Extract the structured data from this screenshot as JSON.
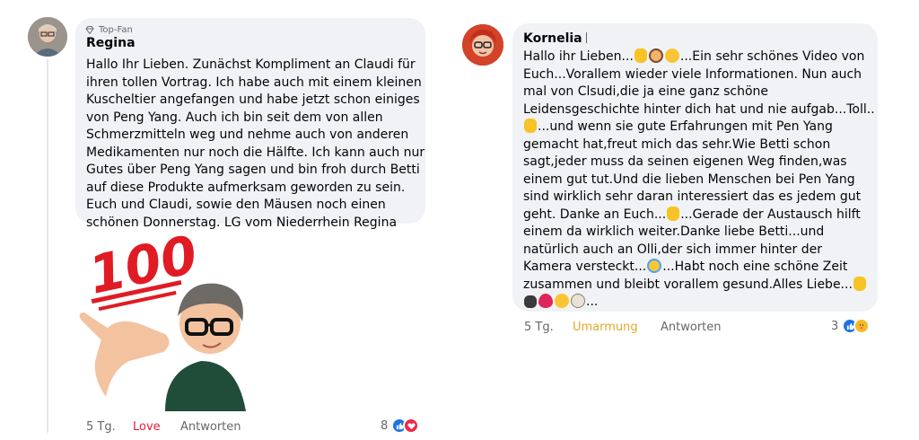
{
  "comments": [
    {
      "badge": "Top-Fan",
      "author": "Regina",
      "lines": [
        "Hallo Ihr Lieben. Zunächst Kompliment an Claudi für",
        "ihren tollen Vortrag. Ich habe auch mit einem kleinen",
        "Kuscheltier angefangen und habe jetzt schon einiges",
        "von Peng Yang. Auch ich bin seit dem von allen",
        "Schmerzmitteln weg und nehme auch von anderen",
        "Medikamenten nur noch die Hälfte. Ich kann auch nur",
        "Gutes über Peng Yang sagen und bin froh durch Betti",
        "auf diese Produkte aufmerksam geworden zu sein.",
        "Euch und Claudi, sowie den Mäusen noch einen",
        "schönen Donnerstag. LG vom Niederrhein Regina"
      ],
      "sticker": {
        "label": "100",
        "icon": "sticker-100-memoji"
      },
      "time": "5 Tg.",
      "reaction_label": "Love",
      "reply_label": "Antworten",
      "reaction_count": "8",
      "reaction_icons": [
        "like-icon",
        "love-icon"
      ]
    },
    {
      "author": "Kornelia",
      "lines": [
        "Hallo ihr Lieben...{thumb}{woman}{face}...Ein sehr schönes Video von",
        "Euch...Vorallem wieder viele Informationen. Nun auch",
        "mal von Clsudi,die ja eine ganz schöne",
        "Leidensgeschichte hinter dich hat und nie aufgab...Toll..",
        "{thumb}...und wenn sie gute Erfahrungen mit Pen Yang",
        "gemacht hat,freut mich das sehr.Wie Betti schon",
        "sagt,jeder muss da seinen eigenen Weg finden,was",
        "einem gut tut.Und die lieben Menschen bei Pen Yang",
        "sind wirklich sehr daran interessiert das es jedem gut",
        "geht. Danke an Euch...{thumb}...Gerade der Austausch hilft",
        "einem da wirklich weiter.Danke liebe Betti...und",
        "natürlich auch an Olli,der sich immer hinter der",
        "Kamera versteckt...{laugh}...Habt noch eine schöne Zeit",
        "zusammen und bleibt vorallem gesund.Alles Liebe...{thumb}",
        "{paws}{heart}{face}{dog}..."
      ],
      "time": "5 Tg.",
      "reaction_label": "Umarmung",
      "reply_label": "Antworten",
      "reaction_count": "3",
      "reaction_icons": [
        "like-icon",
        "care-icon"
      ]
    }
  ],
  "colors": {
    "bubble": "#f0f2f5",
    "love": "#e41e3f",
    "umarmung": "#e2a82a",
    "meta": "#65676b",
    "like": "#1b74e4"
  }
}
